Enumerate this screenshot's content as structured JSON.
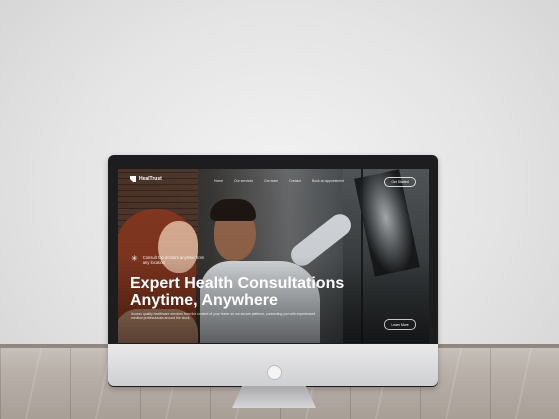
{
  "site": {
    "brand": "HealTrust"
  },
  "nav": {
    "links": [
      "Home",
      "Our services",
      "Our team",
      "Contact",
      "Book an appointment"
    ],
    "cta_label": "Get Started"
  },
  "hero": {
    "tagline": "Consult top doctors anytime from any location",
    "tagline_icon": "sparkle-icon",
    "headline_line1": "Expert Health Consultations",
    "headline_line2": "Anytime, Anywhere",
    "description": "Access quality healthcare services from the comfort of your home on our secure platform, connecting you with experienced medical professionals around the clock.",
    "cta_label": "Learn More"
  },
  "colors": {
    "text": "#ffffff",
    "monitor_bezel": "#1d1d1f",
    "monitor_chin": "#e0e0e2"
  }
}
